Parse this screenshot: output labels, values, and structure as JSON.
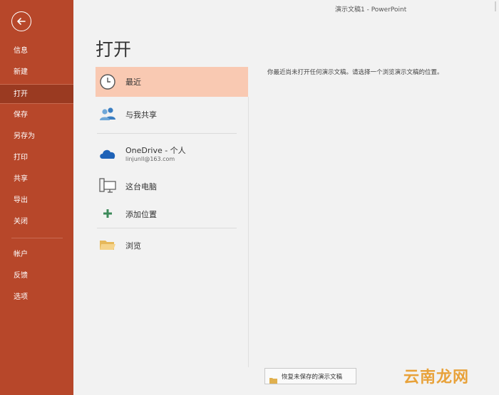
{
  "window": {
    "title": "演示文稿1  -  PowerPoint"
  },
  "sidebar": {
    "items": [
      {
        "label": "信息"
      },
      {
        "label": "新建"
      },
      {
        "label": "打开"
      },
      {
        "label": "保存"
      },
      {
        "label": "另存为"
      },
      {
        "label": "打印"
      },
      {
        "label": "共享"
      },
      {
        "label": "导出"
      },
      {
        "label": "关闭"
      },
      {
        "label": "帐户"
      },
      {
        "label": "反馈"
      },
      {
        "label": "选项"
      }
    ],
    "active": "打开",
    "color": "#b7472a"
  },
  "main": {
    "heading": "打开",
    "locations": [
      {
        "label": "最近",
        "icon": "clock-icon"
      },
      {
        "label": "与我共享",
        "icon": "people-icon"
      },
      {
        "label": "OneDrive - 个人",
        "sub": "linjunll@163.com",
        "icon": "onedrive-cloud-icon"
      },
      {
        "label": "这台电脑",
        "icon": "computer-icon"
      },
      {
        "label": "添加位置",
        "icon": "plus-icon"
      },
      {
        "label": "浏览",
        "icon": "folder-icon"
      }
    ],
    "empty_message": "你最近尚未打开任何演示文稿。请选择一个浏览演示文稿的位置。",
    "recover_button": "恢复未保存的演示文稿"
  },
  "watermark": "云南龙网"
}
